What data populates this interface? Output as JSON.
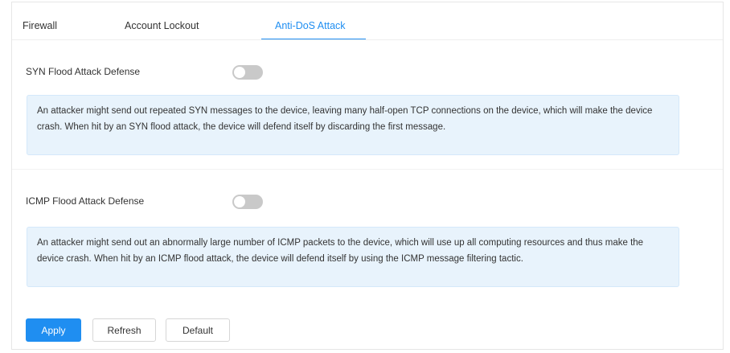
{
  "tabs": [
    {
      "label": "Firewall",
      "active": false
    },
    {
      "label": "Account Lockout",
      "active": false
    },
    {
      "label": "Anti-DoS Attack",
      "active": true
    }
  ],
  "syn": {
    "label": "SYN Flood Attack Defense",
    "enabled": false,
    "description": "An attacker might send out repeated SYN messages to the device, leaving many half-open TCP connections on the device, which will make the device crash. When hit by an SYN flood attack, the device will defend itself by discarding the first message."
  },
  "icmp": {
    "label": "ICMP Flood Attack Defense",
    "enabled": false,
    "description": "An attacker might send out an abnormally large number of ICMP packets to the device, which will use up all computing resources and thus make the device crash. When hit by an ICMP flood attack, the device will defend itself by using the ICMP message filtering tactic."
  },
  "buttons": {
    "apply": "Apply",
    "refresh": "Refresh",
    "default": "Default"
  },
  "colors": {
    "accent": "#1f8ef1",
    "info_background": "#e8f3fc",
    "toggle_off": "#c9c9c9"
  }
}
